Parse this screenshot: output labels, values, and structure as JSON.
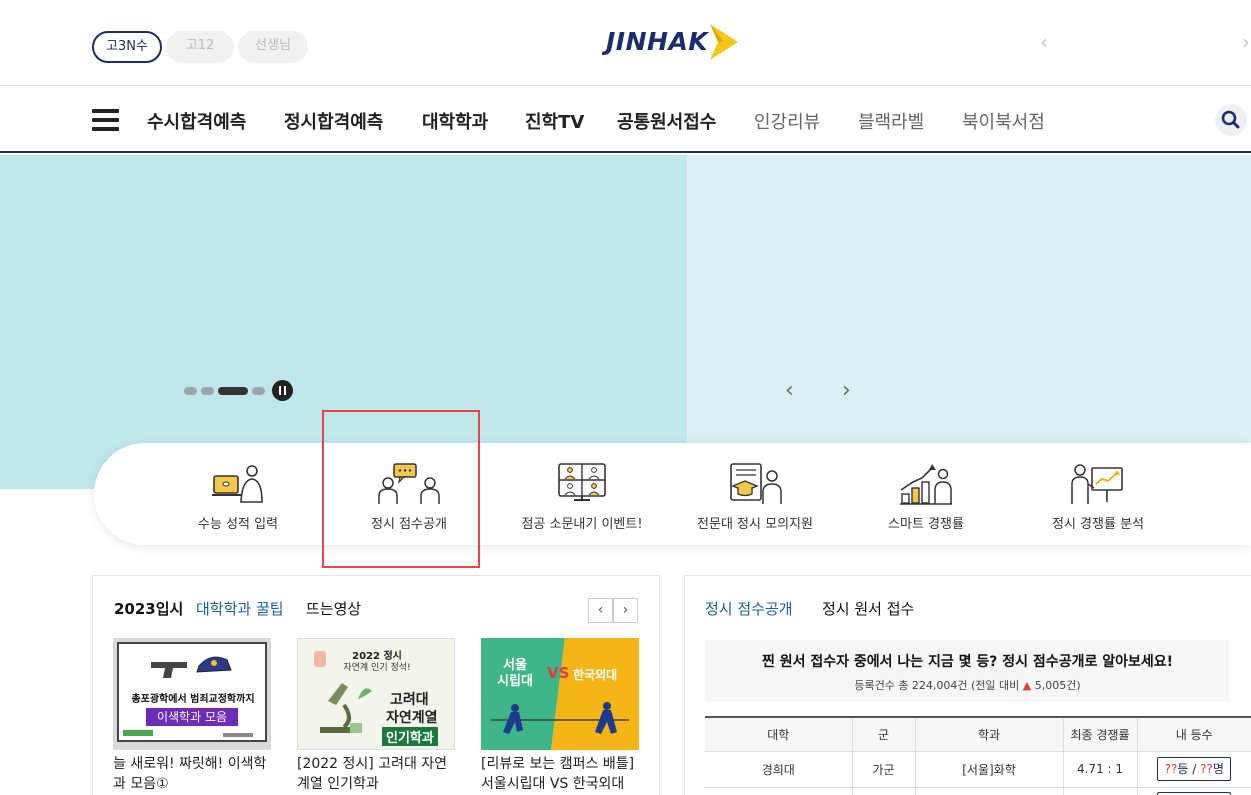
{
  "header": {
    "grade_tabs": [
      "고3N수",
      "고12",
      "선생님"
    ],
    "logo_text": "JINHAK",
    "prev_glyph": "‹",
    "next_glyph": "›"
  },
  "nav": {
    "items": [
      "수시합격예측",
      "정시합격예측",
      "대학학과",
      "진학TV",
      "공통원서접수",
      "인강리뷰",
      "블랙라벨",
      "북이북서점"
    ]
  },
  "banner": {
    "slide_count": 4,
    "active_slide_index": 2,
    "prev_glyph": "‹",
    "next_glyph": "›"
  },
  "quick_menu": {
    "items": [
      {
        "label": "수능 성적 입력",
        "icon": "laptop-person-icon"
      },
      {
        "label": "정시 점수공개",
        "icon": "two-people-chat-icon"
      },
      {
        "label": "점공 소문내기 이벤트!",
        "icon": "video-call-grid-icon"
      },
      {
        "label": "전문대 정시 모의지원",
        "icon": "graduate-certificate-icon"
      },
      {
        "label": "스마트 경쟁률",
        "icon": "growth-chart-icon"
      },
      {
        "label": "정시 경쟁률 분석",
        "icon": "presentation-board-icon"
      }
    ]
  },
  "left_panel": {
    "tabs": [
      "2023입시",
      "대학학과 꿀팁",
      "뜨는영상"
    ],
    "prev_glyph": "‹",
    "next_glyph": "›",
    "cards": [
      {
        "thumb_lines": [
          "총포광학에서 범죄교정학까지",
          "이색학과 모음"
        ],
        "caption": "늘 새로워! 짜릿해! 이색학과 모음①"
      },
      {
        "thumb_lines": [
          "2022 정시",
          "자연계 인기 정석!",
          "고려대",
          "자연계열",
          "인기학과"
        ],
        "caption": "[2022 정시] 고려대 자연계열 인기학과"
      },
      {
        "thumb_lines": [
          "서울",
          "시립대",
          "VS",
          "한국외대"
        ],
        "caption": "[리뷰로 보는 캠퍼스 배틀] 서울시립대 VS 한국외대"
      }
    ]
  },
  "right_panel": {
    "tabs": [
      "정시 점수공개",
      "정시 원서 접수"
    ],
    "info_title": "찐 원서 접수자 중에서 나는 지금 몇 등? 정시 점수공개로 알아보세요!",
    "info_sub_prefix": "등록건수 총 224,004건 (전일 대비 ",
    "info_up_glyph": "▲",
    "info_sub_suffix": " 5,005건)",
    "table": {
      "headers": [
        "대학",
        "군",
        "학과",
        "최종 경쟁률",
        "내 등수"
      ],
      "rows": [
        {
          "univ": "경희대",
          "group": "가군",
          "dept": "[서울]화학",
          "ratio": "4.71 : 1",
          "rank_a": "??",
          "rank_sep": "등 / ",
          "rank_b": "??",
          "rank_end": "명"
        }
      ]
    }
  },
  "colors": {
    "brand_navy": "#1b2d6b",
    "banner_left": "#bfe8ec",
    "banner_right": "#d9f1f4",
    "highlight_red": "#e8454a",
    "tab_active_blue": "#1c5ea8"
  }
}
